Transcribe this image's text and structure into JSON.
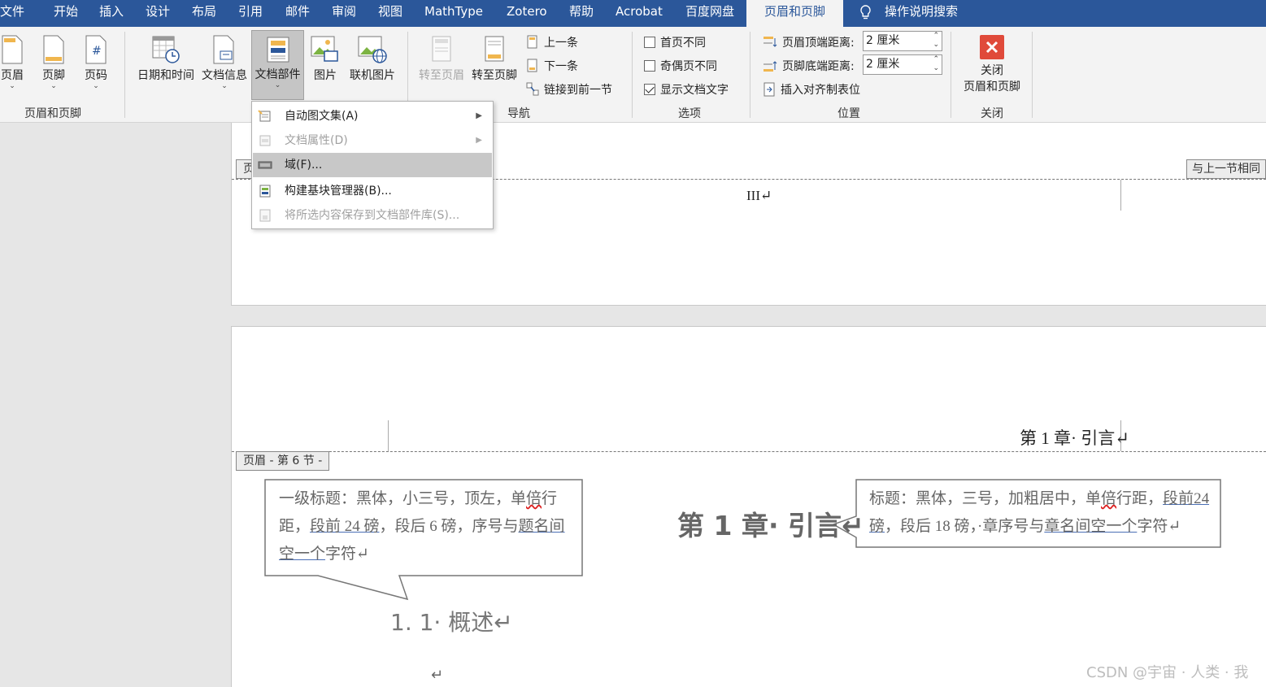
{
  "menubar": {
    "tabs": [
      "文件",
      "开始",
      "插入",
      "设计",
      "布局",
      "引用",
      "邮件",
      "审阅",
      "视图",
      "MathType",
      "Zotero",
      "帮助",
      "Acrobat",
      "百度网盘"
    ],
    "active_tab": "页眉和页脚",
    "search_label": "操作说明搜索"
  },
  "ribbon": {
    "hf_group": {
      "header_label": "页眉",
      "footer_label": "页脚",
      "pagenum_label": "页码",
      "group_label": "页眉和页脚"
    },
    "insert_group": {
      "datetime_label": "日期和时间",
      "docinfo_label": "文档信息",
      "docparts_label": "文档部件",
      "picture_label": "图片",
      "online_picture_label": "联机图片"
    },
    "nav_group": {
      "goto_header_label": "转至页眉",
      "goto_footer_label": "转至页脚",
      "prev_label": "上一条",
      "next_label": "下一条",
      "link_prev_label": "链接到前一节",
      "group_label": "导航"
    },
    "options_group": {
      "diff_first_label": "首页不同",
      "diff_oddeven_label": "奇偶页不同",
      "show_doc_text_label": "显示文档文字",
      "group_label": "选项"
    },
    "position_group": {
      "header_top_label": "页眉顶端距离:",
      "header_top_value": "2 厘米",
      "footer_bottom_label": "页脚底端距离:",
      "footer_bottom_value": "2 厘米",
      "insert_align_tab_label": "插入对齐制表位",
      "group_label": "位置"
    },
    "close_group": {
      "close_label_line1": "关闭",
      "close_label_line2": "页眉和页脚",
      "group_label": "关闭"
    }
  },
  "dropdown": {
    "items": [
      {
        "label": "自动图文集(A)",
        "enabled": true,
        "submenu": true
      },
      {
        "label": "文档属性(D)",
        "enabled": false,
        "submenu": true
      },
      {
        "label": "域(F)...",
        "enabled": true,
        "submenu": false,
        "highlighted": true
      },
      {
        "label": "构建基块管理器(B)...",
        "enabled": true,
        "submenu": false
      },
      {
        "label": "将所选内容保存到文档部件库(S)...",
        "enabled": false,
        "submenu": false
      }
    ]
  },
  "page1": {
    "header_tag": "页",
    "same_as_prev_tag": "与上一节相同",
    "page_number": "III↵"
  },
  "page2": {
    "header_text": "第 1 章· 引言↵",
    "header_tag": "页眉 - 第 6 节 -",
    "chapter_heading": "第 1 章· 引言↵",
    "section_heading": "1. 1· 概述↵",
    "empty_para": "↵",
    "callout_left": {
      "t1": "一级标题：黑体，小三号，顶左，单",
      "t2": "倍",
      "t3": "行",
      "t4": "距，",
      "t5": "段前 24 磅",
      "t6": "，段后 6 磅，序号与",
      "t7": "题名间",
      "t8": "空一个",
      "t9": "字符↵"
    },
    "callout_right": {
      "t1": "标题：黑体，三号，加粗居中，单",
      "t2": "倍",
      "t3": "行距，",
      "t4": "段前",
      "t5": "24 磅",
      "t6": "，段后 18 磅，·章序号与",
      "t7": "章名间空一个",
      "t8": "字符↵"
    }
  },
  "watermark": "CSDN @宇宙 · 人类 · 我"
}
